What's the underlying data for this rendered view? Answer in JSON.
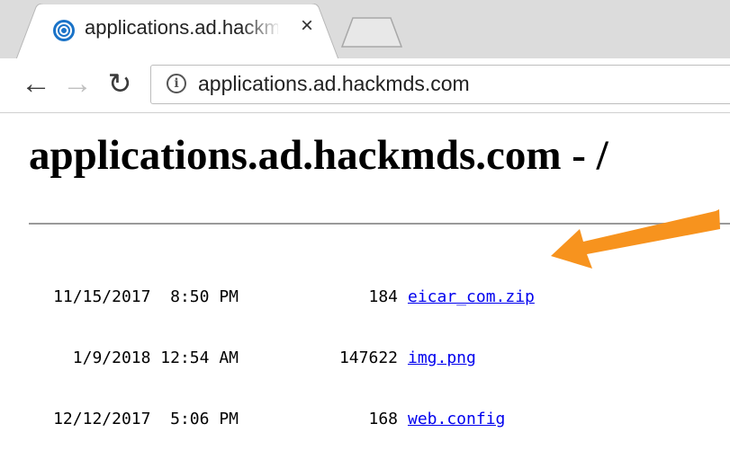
{
  "browser": {
    "tab": {
      "title": "applications.ad.hackmds.com",
      "close_glyph": "×",
      "favicon": "globe-icon"
    },
    "nav": {
      "back": "←",
      "forward": "→",
      "reload": "↻"
    },
    "address_bar": {
      "info_glyph": "i",
      "url": "applications.ad.hackmds.com"
    }
  },
  "page": {
    "title": "applications.ad.hackmds.com - /",
    "listing": [
      {
        "date": "11/15/2017  8:50 PM",
        "size": "184",
        "name": "eicar_com.zip"
      },
      {
        "date": "1/9/2018 12:54 AM",
        "size": "147622",
        "name": "img.png"
      },
      {
        "date": "12/12/2017  5:06 PM",
        "size": "168",
        "name": "web.config"
      }
    ]
  },
  "annotation": {
    "color": "#f7931e"
  }
}
